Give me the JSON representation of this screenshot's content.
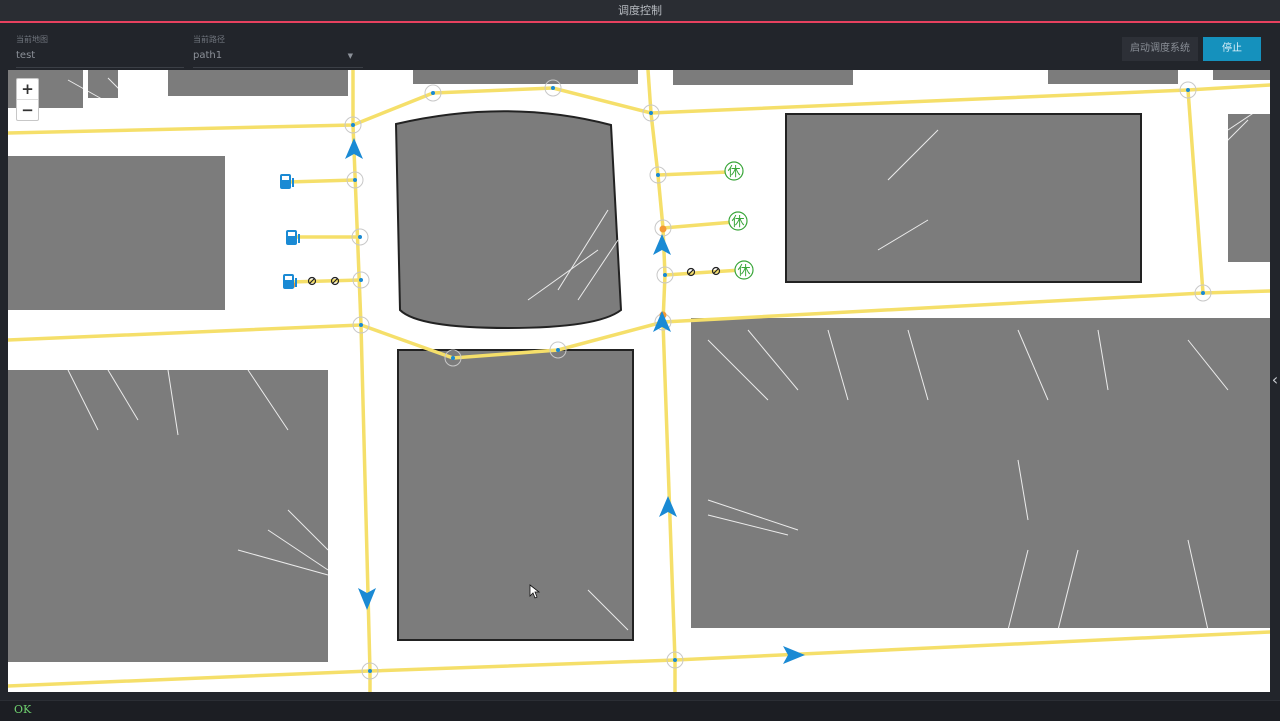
{
  "window": {
    "title": "调度控制"
  },
  "toolbar": {
    "map_label": "当前地图",
    "map_value": "test",
    "path_label": "当前路径",
    "path_value": "path1",
    "start_button": "启动调度系统",
    "stop_button": "停止"
  },
  "map": {
    "zoom_in": "+",
    "zoom_out": "−",
    "rest_label": "休",
    "colors": {
      "route": "#f5df6a",
      "vehicle": "#1a8ad4",
      "obstacle": "#7c7c7c",
      "rest": "#3aa63a",
      "marker": "#f39a36"
    }
  },
  "status": {
    "text": "OK"
  }
}
